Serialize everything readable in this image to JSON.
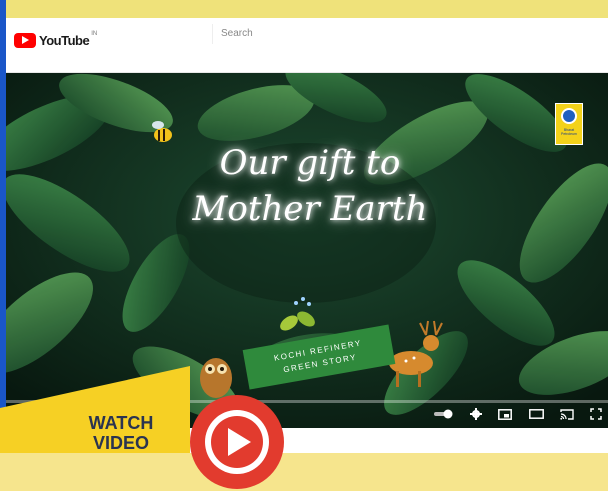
{
  "header": {
    "logo_text": "YouTube",
    "country_code": "IN",
    "search_placeholder": "Search"
  },
  "video": {
    "title_line1": "Our gift to",
    "title_line2": "Mother Earth",
    "ribbon_line1": "KOCHI REFINERY",
    "ribbon_line2": "GREEN STORY",
    "brand_badge": "Bharat Petroleum"
  },
  "player_controls": {
    "icons": [
      "autoplay-toggle-icon",
      "settings-gear-icon",
      "miniplayer-icon",
      "theater-mode-icon",
      "cast-icon",
      "fullscreen-icon"
    ]
  },
  "promo": {
    "watch_line1": "WATCH",
    "watch_line2": "VIDEO"
  },
  "colors": {
    "frame_yellow": "#efe27a",
    "frame_blue": "#1a56c8",
    "youtube_red": "#ff0000",
    "play_red": "#e23b2e",
    "promo_yellow": "#f6d024",
    "ribbon_green": "#2f8a3c"
  }
}
